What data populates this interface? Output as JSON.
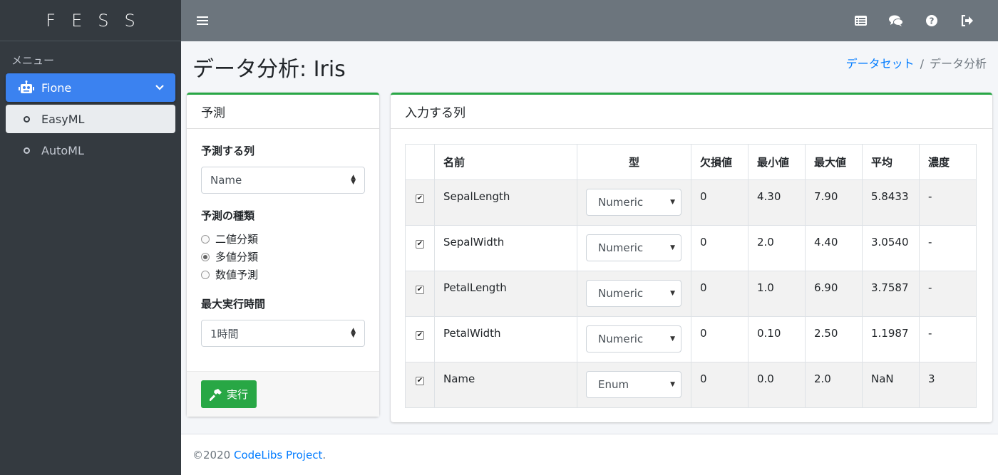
{
  "brand": "FESS",
  "sidebar": {
    "menu_header": "メニュー",
    "items": [
      {
        "label": "Fione",
        "icon": "robot-icon",
        "active": true
      },
      {
        "label": "EasyML",
        "icon": "circle-icon",
        "active": true
      },
      {
        "label": "AutoML",
        "icon": "circle-icon",
        "active": false
      }
    ]
  },
  "topbar": {
    "icons": [
      "menu-icon",
      "list-icon",
      "chat-icon",
      "help-icon",
      "logout-icon"
    ]
  },
  "page": {
    "title": "データ分析: Iris",
    "breadcrumb": {
      "link": "データセット",
      "separator": "/",
      "current": "データ分析"
    }
  },
  "left_card": {
    "header": "予測",
    "target_label": "予測する列",
    "target_value": "Name",
    "type_label": "予測の種類",
    "types": [
      {
        "label": "二値分類",
        "checked": false
      },
      {
        "label": "多値分類",
        "checked": true
      },
      {
        "label": "数値予測",
        "checked": false
      }
    ],
    "time_label": "最大実行時間",
    "time_value": "1時間",
    "run_button": "実行"
  },
  "right_card": {
    "header": "入力する列",
    "columns": [
      "名前",
      "型",
      "欠損値",
      "最小値",
      "最大値",
      "平均",
      "濃度"
    ],
    "rows": [
      {
        "checked": true,
        "name": "SepalLength",
        "type": "Numeric",
        "missing": "0",
        "min": "4.30",
        "max": "7.90",
        "mean": "5.8433",
        "cardinality": "-"
      },
      {
        "checked": true,
        "name": "SepalWidth",
        "type": "Numeric",
        "missing": "0",
        "min": "2.0",
        "max": "4.40",
        "mean": "3.0540",
        "cardinality": "-"
      },
      {
        "checked": true,
        "name": "PetalLength",
        "type": "Numeric",
        "missing": "0",
        "min": "1.0",
        "max": "6.90",
        "mean": "3.7587",
        "cardinality": "-"
      },
      {
        "checked": true,
        "name": "PetalWidth",
        "type": "Numeric",
        "missing": "0",
        "min": "0.10",
        "max": "2.50",
        "mean": "1.1987",
        "cardinality": "-"
      },
      {
        "checked": true,
        "name": "Name",
        "type": "Enum",
        "missing": "0",
        "min": "0.0",
        "max": "2.0",
        "mean": "NaN",
        "cardinality": "3"
      }
    ]
  },
  "footer": {
    "prefix": "©2020 ",
    "link": "CodeLibs Project",
    "suffix": "."
  }
}
